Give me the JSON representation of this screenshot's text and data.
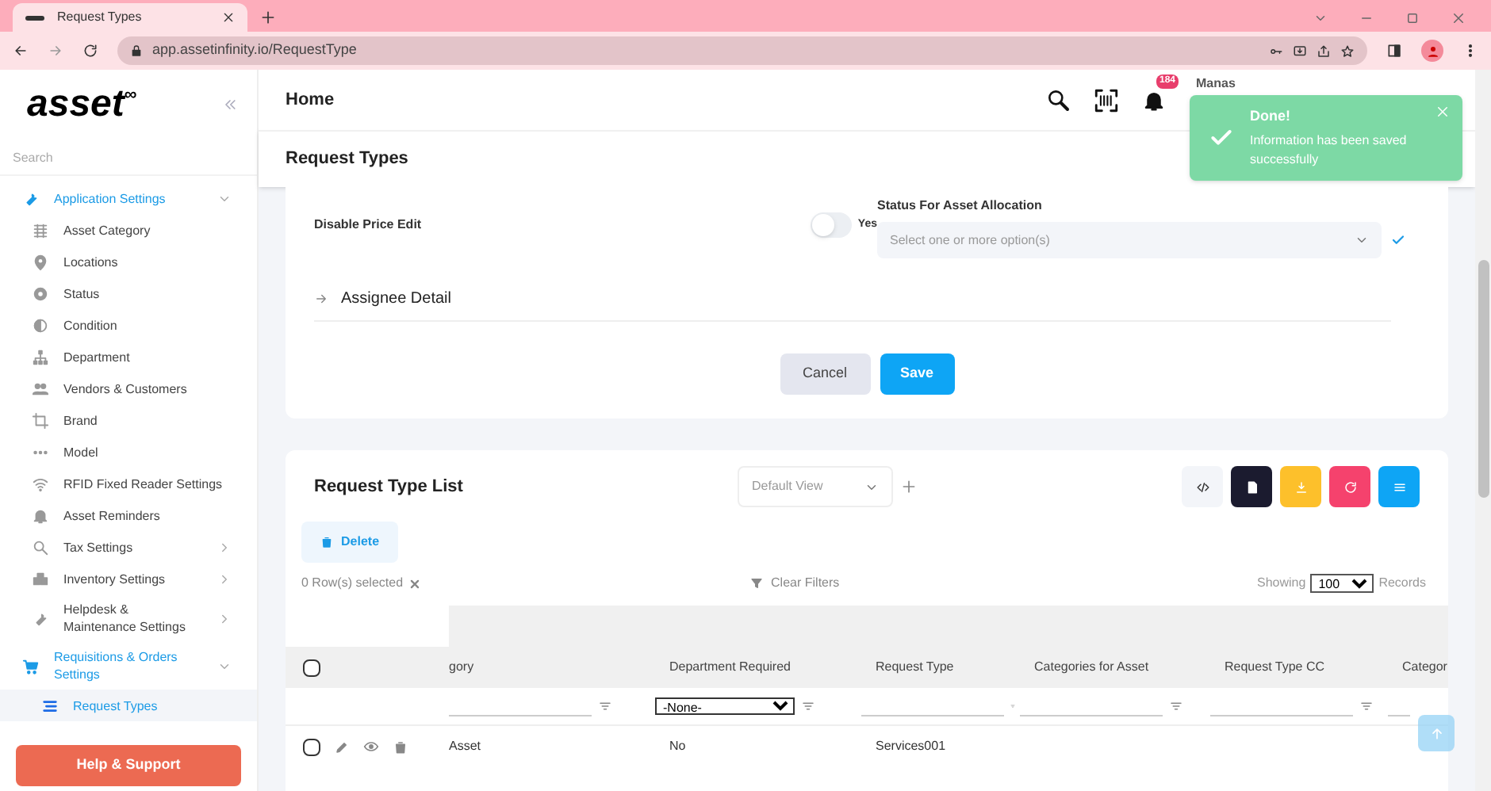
{
  "browser": {
    "tab_title": "Request Types",
    "url": "app.assetinfinity.io/RequestType"
  },
  "sidebar": {
    "logo": "asset",
    "logo_mark": "∞",
    "search_placeholder": "Search",
    "items": [
      {
        "label": "Application Settings",
        "kind": "wrench",
        "expanded": true,
        "selected": true,
        "children": [
          {
            "label": "Asset Category",
            "kind": "grid",
            "has_submenu": false
          },
          {
            "label": "Locations",
            "kind": "pin",
            "has_submenu": false
          },
          {
            "label": "Status",
            "kind": "dot",
            "has_submenu": false
          },
          {
            "label": "Condition",
            "kind": "half",
            "has_submenu": false
          },
          {
            "label": "Department",
            "kind": "org",
            "has_submenu": false
          },
          {
            "label": "Vendors & Customers",
            "kind": "users",
            "has_submenu": false
          },
          {
            "label": "Brand",
            "kind": "crop",
            "has_submenu": false
          },
          {
            "label": "Model",
            "kind": "dots",
            "has_submenu": false
          },
          {
            "label": "RFID Fixed Reader Settings",
            "kind": "wifi",
            "has_submenu": false
          },
          {
            "label": "Asset Reminders",
            "kind": "bell",
            "has_submenu": false
          },
          {
            "label": "Tax Settings",
            "kind": "search",
            "has_submenu": true
          },
          {
            "label": "Inventory Settings",
            "kind": "boxes",
            "has_submenu": true
          },
          {
            "label": "Helpdesk & Maintenance Settings",
            "kind": "wrench",
            "has_submenu": true
          }
        ]
      },
      {
        "label": "Requisitions & Orders Settings",
        "kind": "cart",
        "expanded": true,
        "selected": true,
        "children": [
          {
            "label": "Request Types",
            "kind": "list",
            "selected": true,
            "has_submenu": false
          }
        ]
      }
    ],
    "help_button": "Help & Support"
  },
  "header": {
    "title": "Home",
    "notification_count": "184",
    "user_name": "Manas"
  },
  "toast": {
    "title": "Done!",
    "message": "Information has been saved successfully"
  },
  "page_title": "Request Types",
  "form": {
    "toggle_label": "Disable Price Edit",
    "toggle": {
      "on": false,
      "label": "Yes"
    },
    "status_label": "Status For Asset Allocation",
    "status_placeholder": "Select one or more option(s)",
    "section": "Assignee Detail",
    "cancel": "Cancel",
    "save": "Save"
  },
  "list": {
    "title": "Request Type List",
    "view": "Default View",
    "delete": "Delete",
    "selected_count": "0 Row(s) selected",
    "clear_filters": "Clear Filters",
    "showing": "Showing",
    "page_size": "100",
    "records": "Records",
    "all_checked": false,
    "columns": [
      "gory",
      "Department Required",
      "Request Type",
      "Categories for Asset",
      "Request Type CC",
      "Categor"
    ],
    "filters": [
      {
        "kind": "text"
      },
      {
        "kind": "select",
        "value": "-None-"
      },
      {
        "kind": "text"
      },
      {
        "kind": "text"
      },
      {
        "kind": "text"
      },
      {
        "kind": "text"
      }
    ],
    "rows": [
      {
        "checked": false,
        "cells": [
          "Asset",
          "No",
          "Services001",
          "",
          "",
          ""
        ]
      }
    ]
  }
}
